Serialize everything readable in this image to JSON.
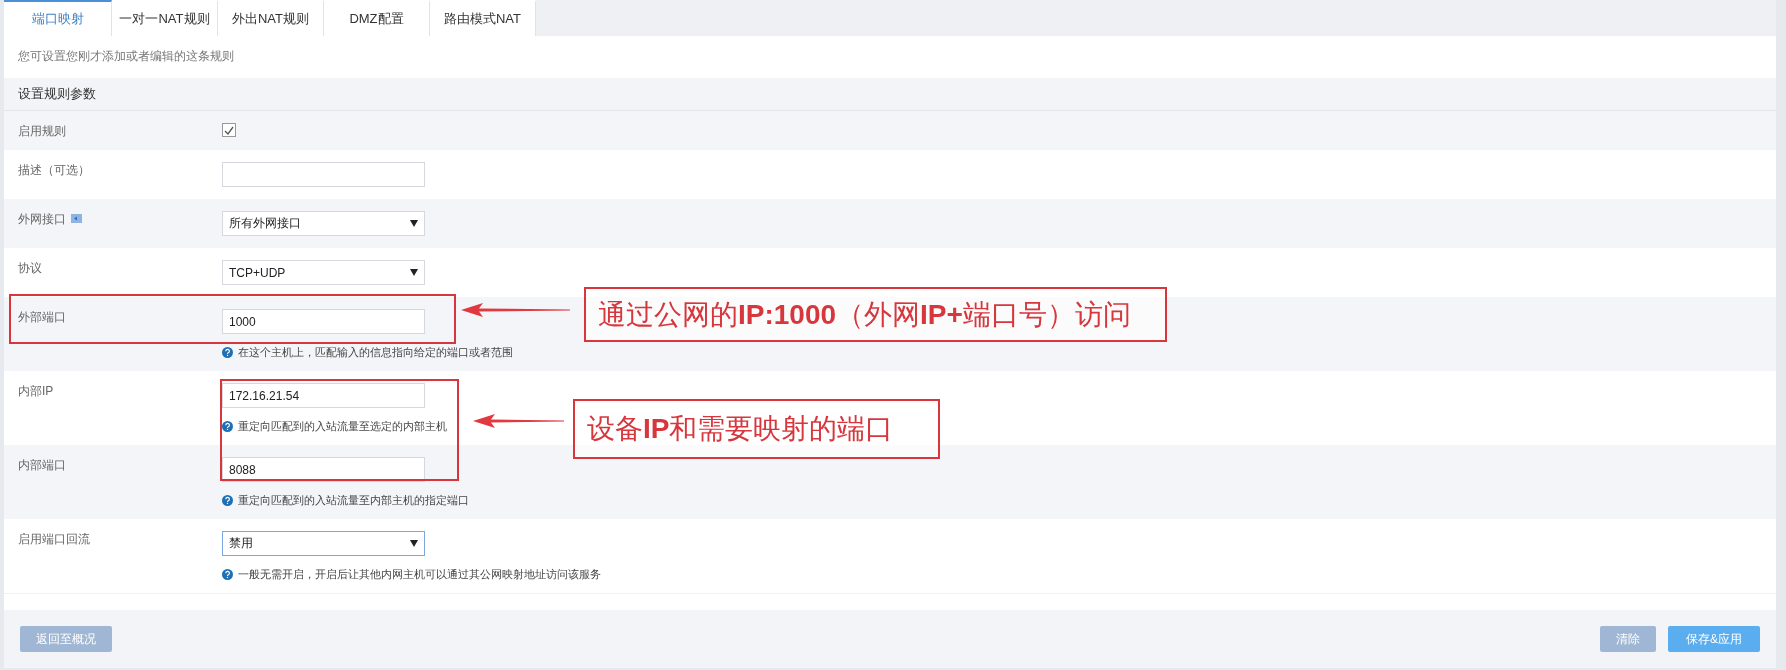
{
  "tabs": [
    {
      "label": "端口映射",
      "selected": true
    },
    {
      "label": "一对一NAT规则",
      "selected": false
    },
    {
      "label": "外出NAT规则",
      "selected": false
    },
    {
      "label": "DMZ配置",
      "selected": false
    },
    {
      "label": "路由模式NAT",
      "selected": false
    }
  ],
  "intro": "您可设置您刚才添加或者编辑的这条规则",
  "section_title": "设置规则参数",
  "rows": [
    {
      "kind": "checkbox",
      "label": "启用规则",
      "checked": true
    },
    {
      "kind": "text",
      "label": "描述（可选）"
    },
    {
      "kind": "select",
      "label": "外网接口",
      "info_icon": true,
      "value": "所有外网接口",
      "focused": false
    },
    {
      "kind": "select",
      "label": "协议",
      "value": "TCP+UDP",
      "focused": false
    },
    {
      "kind": "text",
      "label": "外部端口",
      "value": "1000",
      "help": "在这个主机上，匹配输入的信息指向给定的端口或者范围"
    },
    {
      "kind": "text",
      "label": "内部IP",
      "value": "172.16.21.54",
      "help": "重定向匹配到的入站流量至选定的内部主机"
    },
    {
      "kind": "text",
      "label": "内部端口",
      "value": "8088",
      "help": "重定向匹配到的入站流量至内部主机的指定端口"
    },
    {
      "kind": "select",
      "label": "启用端口回流",
      "value": "禁用",
      "focused": true,
      "help": "一般无需开启，开启后让其他内网主机可以通过其公网映射地址访问该服务"
    }
  ],
  "annotations": [
    {
      "text": "通过公网的**IP:1000**（外网**IP+**端口号）访问"
    },
    {
      "text": "设备**IP**和需要映射的端口"
    }
  ],
  "footer": {
    "left_buttons": [
      {
        "label": "返回至概况",
        "disabled": true
      }
    ],
    "right_buttons": [
      {
        "label": "清除",
        "disabled": true
      },
      {
        "label": "保存&应用",
        "disabled": false
      }
    ]
  }
}
